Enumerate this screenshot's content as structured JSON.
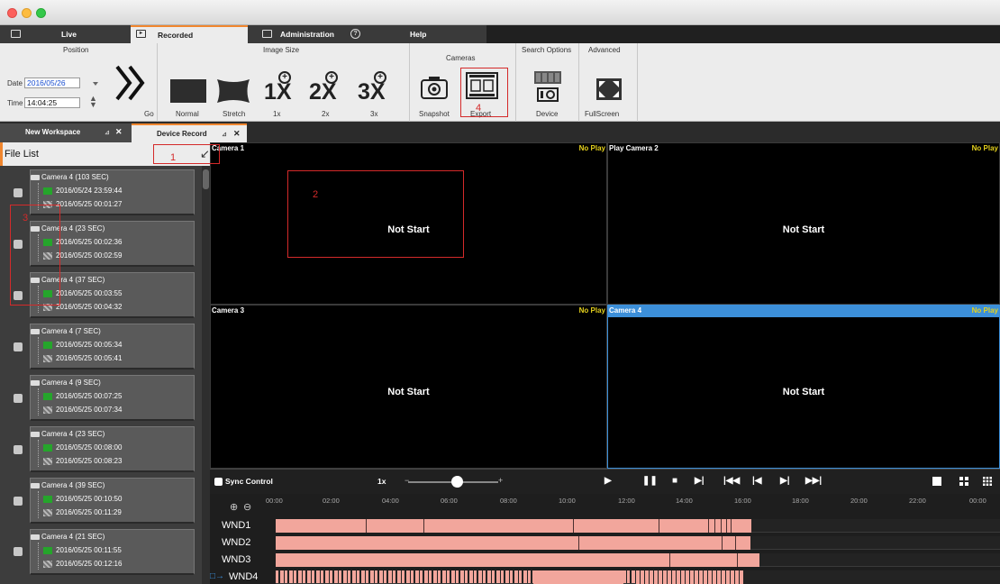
{
  "main_tabs": {
    "live": "Live",
    "recorded": "Recorded",
    "administration": "Administration",
    "help": "Help"
  },
  "ribbon": {
    "position": {
      "title": "Position",
      "date_label": "Date",
      "date_value": "2016/05/26",
      "time_label": "Time",
      "time_value": "14:04:25",
      "go_label": "Go"
    },
    "image_size": {
      "title": "Image Size",
      "normal": "Normal",
      "stretch": "Stretch",
      "x1": "1x",
      "x2": "2x",
      "x3": "3x",
      "x1_big": "1X",
      "x2_big": "2X",
      "x3_big": "3X"
    },
    "cameras": {
      "title": "Cameras",
      "snapshot": "Snapshot",
      "export": "Export"
    },
    "search_options": {
      "title": "Search Options",
      "device": "Device"
    },
    "advanced": {
      "title": "Advanced",
      "fullscreen": "FullScreen"
    }
  },
  "workspace_tabs": {
    "new": "New Workspace",
    "device": "Device Record"
  },
  "file_list": {
    "title": "File List",
    "items": [
      {
        "camera": "Camera 4 (103 SEC)",
        "start": "2016/05/24 23:59:44",
        "end": "2016/05/25 00:01:27"
      },
      {
        "camera": "Camera 4 (23 SEC)",
        "start": "2016/05/25 00:02:36",
        "end": "2016/05/25 00:02:59"
      },
      {
        "camera": "Camera 4 (37 SEC)",
        "start": "2016/05/25 00:03:55",
        "end": "2016/05/25 00:04:32"
      },
      {
        "camera": "Camera 4 (7 SEC)",
        "start": "2016/05/25 00:05:34",
        "end": "2016/05/25 00:05:41"
      },
      {
        "camera": "Camera 4 (9 SEC)",
        "start": "2016/05/25 00:07:25",
        "end": "2016/05/25 00:07:34"
      },
      {
        "camera": "Camera 4 (23 SEC)",
        "start": "2016/05/25 00:08:00",
        "end": "2016/05/25 00:08:23"
      },
      {
        "camera": "Camera 4 (39 SEC)",
        "start": "2016/05/25 00:10:50",
        "end": "2016/05/25 00:11:29"
      },
      {
        "camera": "Camera 4 (21 SEC)",
        "start": "2016/05/25 00:11:55",
        "end": "2016/05/25 00:12:16"
      }
    ]
  },
  "video": {
    "cells": [
      {
        "name": "Camera 1",
        "status": "No Play",
        "message": "Not Start"
      },
      {
        "name": "Play Camera 2",
        "status": "No Play",
        "message": "Not Start"
      },
      {
        "name": "Camera 3",
        "status": "No Play",
        "message": "Not Start"
      },
      {
        "name": "Camera 4",
        "status": "No Play",
        "message": "Not Start"
      }
    ]
  },
  "controls": {
    "sync": "Sync Control",
    "speed": "1x"
  },
  "timeline": {
    "ticks": [
      "00:00",
      "02:00",
      "04:00",
      "06:00",
      "08:00",
      "10:00",
      "12:00",
      "14:00",
      "16:00",
      "18:00",
      "20:00",
      "22:00",
      "00:00"
    ],
    "windows": [
      "WND1",
      "WND2",
      "WND3",
      "WND4"
    ]
  },
  "annotations": [
    "1",
    "2",
    "3",
    "4"
  ],
  "colors": {
    "accent": "#f0862e",
    "selection": "#3c8fd9",
    "recording": "#f2a69c",
    "no_play": "#e6d21d",
    "annotation": "#d42a2a"
  }
}
